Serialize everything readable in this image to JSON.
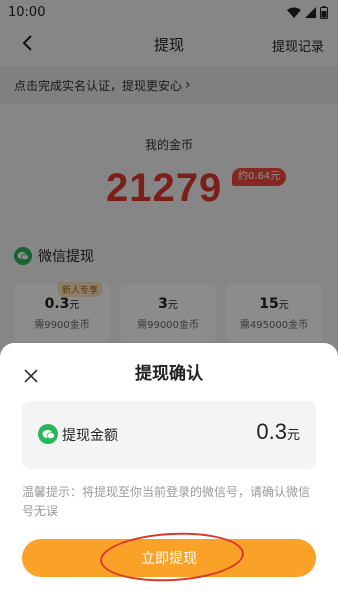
{
  "status_bar": {
    "time": "10:00"
  },
  "nav": {
    "title": "提现",
    "right_label": "提现记录"
  },
  "verify_banner": {
    "text": "点击完成实名认证，提现更安心",
    "arrow": "›"
  },
  "coins": {
    "label": "我的金币",
    "value": "21279",
    "approx": "约0.64元"
  },
  "wechat_section": {
    "label": "微信提现"
  },
  "withdraw_options": [
    {
      "amount": "0.3",
      "unit": "元",
      "cost": "需9900金币",
      "tag": "新人专享"
    },
    {
      "amount": "3",
      "unit": "元",
      "cost": "需99000金币",
      "tag": ""
    },
    {
      "amount": "15",
      "unit": "元",
      "cost": "需495000金币",
      "tag": ""
    }
  ],
  "dialog": {
    "title": "提现确认",
    "amount_label": "提现金额",
    "amount_value": "0.3",
    "amount_unit": "元",
    "tip": "温馨提示：将提现至你当前登录的微信号，请确认微信号无误",
    "confirm_label": "立即提现"
  },
  "colors": {
    "accent": "#f9a227",
    "coin_red": "#e03a2f",
    "wechat_green": "#2ab65a",
    "annotation_red": "#d73a2c"
  }
}
